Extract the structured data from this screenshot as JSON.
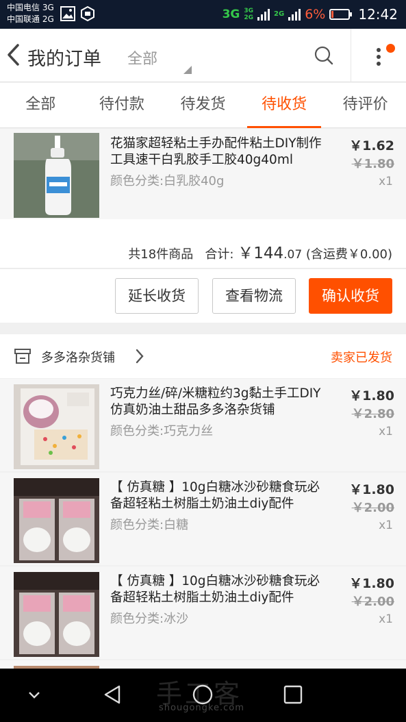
{
  "status_bar": {
    "carrier1": "中国电信 3G",
    "carrier2": "中国联通 2G",
    "network_main": "3G",
    "network_mini_top": "3G",
    "network_mini_bottom": "2G",
    "network_2g": "2G",
    "battery": "6%",
    "time": "12:42"
  },
  "header": {
    "title": "我的订单",
    "filter": "全部"
  },
  "tabs": [
    {
      "label": "全部"
    },
    {
      "label": "待付款"
    },
    {
      "label": "待发货"
    },
    {
      "label": "待收货",
      "active": true
    },
    {
      "label": "待评价"
    }
  ],
  "order1": {
    "items": [
      {
        "name": "花猫家超轻粘土手办配件粘土DIY制作工具速干白乳胶手工胶40g40ml",
        "spec": "颜色分类:白乳胶40g",
        "price": "￥1.62",
        "original_price": "￥1.80",
        "qty": "x1"
      }
    ],
    "summary": {
      "count_text": "共18件商品",
      "total_label": "合计:",
      "total_symbol": "￥",
      "total_int": "144",
      "total_dec": ".07",
      "shipping": "(含运费￥0.00)"
    },
    "buttons": {
      "extend": "延长收货",
      "logistics": "查看物流",
      "confirm": "确认收货"
    }
  },
  "order2": {
    "shop_name": "多多洛杂货铺",
    "status": "卖家已发货",
    "items": [
      {
        "name": "巧克力丝/碎/米糖粒约3g黏土手工DIY仿真奶油土甜品多多洛杂货铺",
        "spec": "颜色分类:巧克力丝",
        "price": "￥1.80",
        "original_price": "￥2.80",
        "qty": "x1"
      },
      {
        "name": "【 仿真糖 】10g白糖冰沙砂糖食玩必备超轻粘土树脂土奶油土diy配件",
        "spec": "颜色分类:白糖",
        "price": "￥1.80",
        "original_price": "￥2.00",
        "qty": "x1"
      },
      {
        "name": "【 仿真糖 】10g白糖冰沙砂糖食玩必备超轻粘土树脂土奶油土diy配件",
        "spec": "颜色分类:冰沙",
        "price": "￥1.80",
        "original_price": "￥2.00",
        "qty": "x1"
      }
    ]
  },
  "watermark": {
    "main": "手工客",
    "sub": "shougongke.com"
  },
  "colors": {
    "accent": "#ff5000",
    "statusbar": "#0f1a2e"
  }
}
